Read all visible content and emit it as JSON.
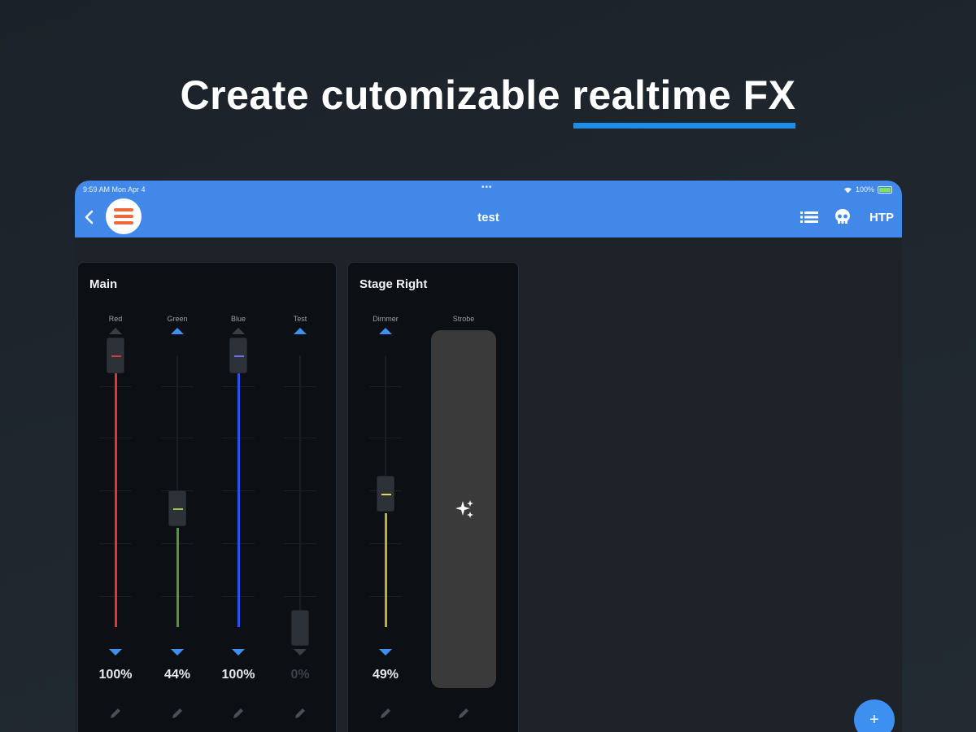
{
  "headline": {
    "text_plain": "Create cutomizable ",
    "text_highlight": "realtime FX"
  },
  "status_bar": {
    "time_date": "9:59 AM   Mon Apr 4",
    "dots": "•••",
    "battery": "100%"
  },
  "app_bar": {
    "title": "test",
    "action_htp": "HTP",
    "menu_icon": "hamburger-icon",
    "back_icon": "chevron-left-icon"
  },
  "panels": {
    "main": {
      "title": "Main",
      "channels": [
        {
          "label": "Red",
          "value": "100%",
          "level": 1.0,
          "color": "#e0353e"
        },
        {
          "label": "Green",
          "value": "44%",
          "level": 0.44,
          "color": "#4f9a33"
        },
        {
          "label": "Blue",
          "value": "100%",
          "level": 1.0,
          "color": "#2a52e0"
        },
        {
          "label": "Test",
          "value": "0%",
          "level": 0.0,
          "color": "#5a5f66"
        }
      ]
    },
    "stage_right": {
      "title": "Stage Right",
      "dimmer": {
        "label": "Dimmer",
        "value": "49%",
        "level": 0.49,
        "color": "#b3b23a"
      },
      "strobe": {
        "label": "Strobe",
        "icon": "sparkle-icon"
      }
    }
  },
  "fab": {
    "label": "+"
  },
  "colors": {
    "accent": "#4188e8",
    "underline": "#1e8ee8",
    "background": "#1e232a"
  }
}
